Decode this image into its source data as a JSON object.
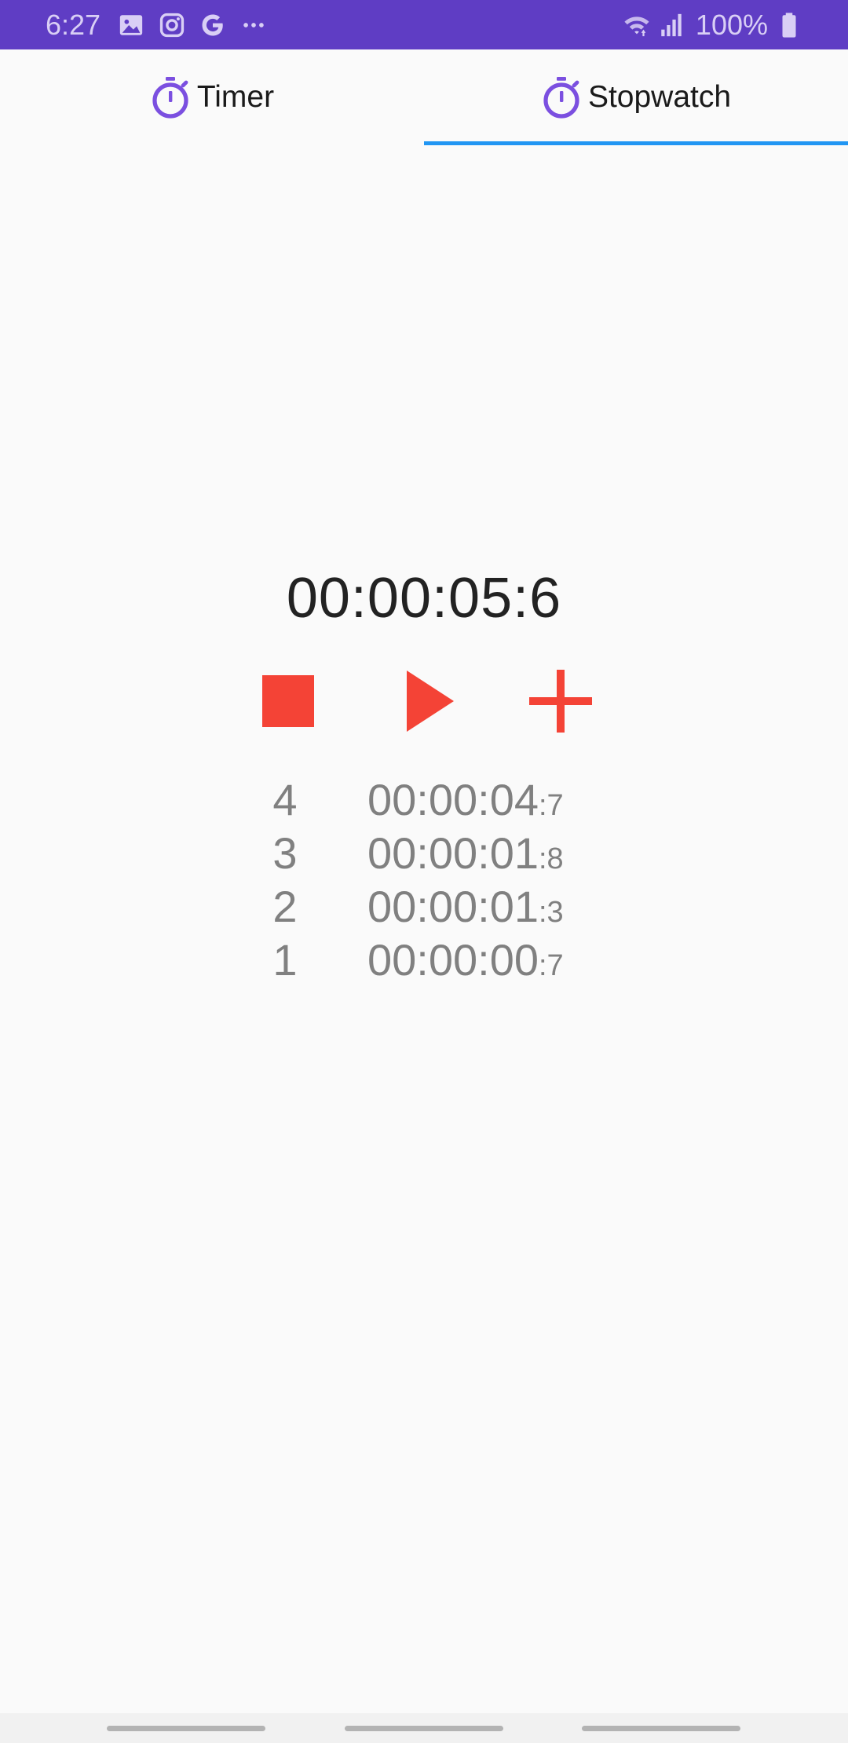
{
  "status_bar": {
    "time": "6:27",
    "battery_text": "100%",
    "left_icons": [
      "gallery-icon",
      "instagram-icon",
      "google-icon",
      "more-icon"
    ],
    "right_icons": [
      "wifi-icon",
      "signal-icon",
      "battery-icon"
    ],
    "background_color": "#5f3dc4"
  },
  "tabs": [
    {
      "label": "Timer",
      "icon": "stopwatch-icon",
      "selected": false
    },
    {
      "label": "Stopwatch",
      "icon": "stopwatch-icon",
      "selected": true
    }
  ],
  "accent_color": "#7b4fe0",
  "indicator_color": "#2196f3",
  "control_color": "#f44336",
  "stopwatch": {
    "elapsed": "00:00:05:6"
  },
  "controls": [
    {
      "name": "stop-button",
      "icon": "stop-icon"
    },
    {
      "name": "play-button",
      "icon": "play-icon"
    },
    {
      "name": "lap-button",
      "icon": "plus-icon"
    }
  ],
  "laps": [
    {
      "number": "4",
      "time": "00:00:04",
      "tenth": ":7"
    },
    {
      "number": "3",
      "time": "00:00:01",
      "tenth": ":8"
    },
    {
      "number": "2",
      "time": "00:00:01",
      "tenth": ":3"
    },
    {
      "number": "1",
      "time": "00:00:00",
      "tenth": ":7"
    }
  ]
}
